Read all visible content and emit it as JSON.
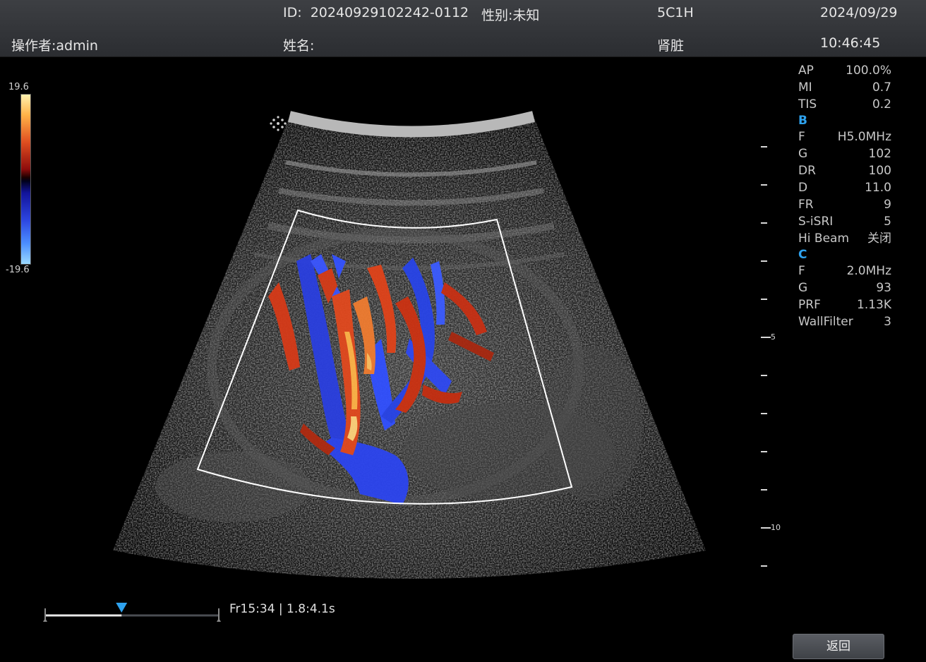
{
  "header": {
    "id_label": "ID:",
    "id_value": "20240929102242-0112",
    "gender_label": "性别:",
    "gender_value": "未知",
    "probe": "5C1H",
    "date": "2024/09/29",
    "operator_label": "操作者:",
    "operator_value": "admin",
    "name_label": "姓名:",
    "name_value": "",
    "exam": "肾脏",
    "time": "10:46:45"
  },
  "color_scale": {
    "max": "19.6",
    "min": "-19.6"
  },
  "params": {
    "general": [
      {
        "k": "AP",
        "v": "100.0%"
      },
      {
        "k": "MI",
        "v": "0.7"
      },
      {
        "k": "TIS",
        "v": "0.2"
      }
    ],
    "b_title": "B",
    "b": [
      {
        "k": "F",
        "v": "H5.0MHz"
      },
      {
        "k": "G",
        "v": "102"
      },
      {
        "k": "DR",
        "v": "100"
      },
      {
        "k": "D",
        "v": "11.0"
      },
      {
        "k": "FR",
        "v": "9"
      },
      {
        "k": "S-iSRI",
        "v": "5"
      },
      {
        "k": "Hi Beam",
        "v": "关闭"
      }
    ],
    "c_title": "C",
    "c": [
      {
        "k": "F",
        "v": "2.0MHz"
      },
      {
        "k": "G",
        "v": "93"
      },
      {
        "k": "PRF",
        "v": "1.13K"
      },
      {
        "k": "WallFilter",
        "v": "3"
      }
    ]
  },
  "depth_labels": {
    "five": "5",
    "ten": "10"
  },
  "cine": {
    "progress": 0.44,
    "info": "Fr15:34 | 1.8:4.1s"
  },
  "return_button": "返回"
}
